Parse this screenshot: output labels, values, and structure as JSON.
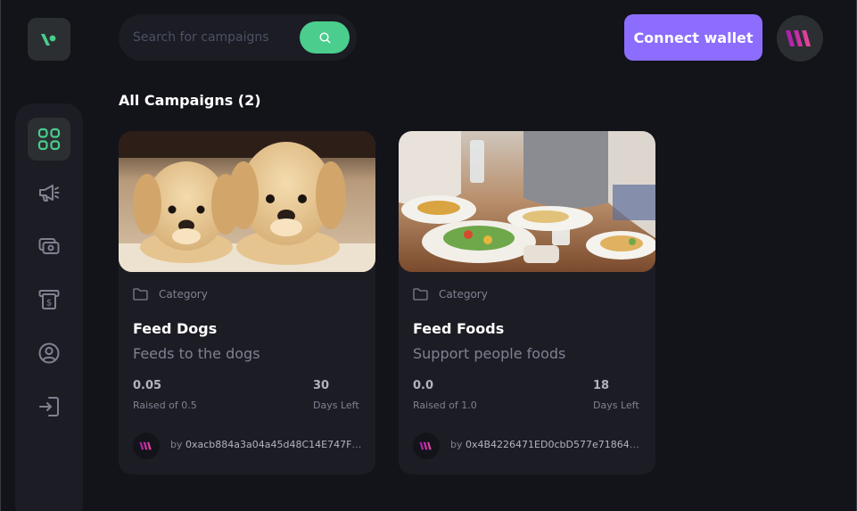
{
  "search": {
    "placeholder": "Search for campaigns"
  },
  "header": {
    "connect_label": "Connect wallet"
  },
  "section": {
    "title": "All Campaigns (2)"
  },
  "sidebar": {
    "items": [
      {
        "icon": "dashboard-icon",
        "active": true
      },
      {
        "icon": "megaphone-icon",
        "active": false
      },
      {
        "icon": "payment-icon",
        "active": false
      },
      {
        "icon": "withdraw-icon",
        "active": false
      },
      {
        "icon": "profile-icon",
        "active": false
      },
      {
        "icon": "logout-icon",
        "active": false
      }
    ]
  },
  "campaigns": [
    {
      "category": "Category",
      "title": "Feed Dogs",
      "description": "Feeds to the dogs",
      "raised": "0.05",
      "raised_label": "Raised of 0.5",
      "days": "30",
      "days_label": "Days Left",
      "owner_prefix": "by",
      "owner": "0xacb884a3a04a45d48C14E747F1…",
      "image": "puppies-photo"
    },
    {
      "category": "Category",
      "title": "Feed Foods",
      "description": "Support people foods",
      "raised": "0.0",
      "raised_label": "Raised of 1.0",
      "days": "18",
      "days_label": "Days Left",
      "owner_prefix": "by",
      "owner": "0x4B4226471ED0cbD577e71864b9…",
      "image": "food-table-photo"
    }
  ],
  "colors": {
    "background": "#13131a",
    "surface": "#1c1c24",
    "accent_green": "#4acd8d",
    "accent_purple": "#8c6dfd",
    "muted_text": "#808191"
  }
}
